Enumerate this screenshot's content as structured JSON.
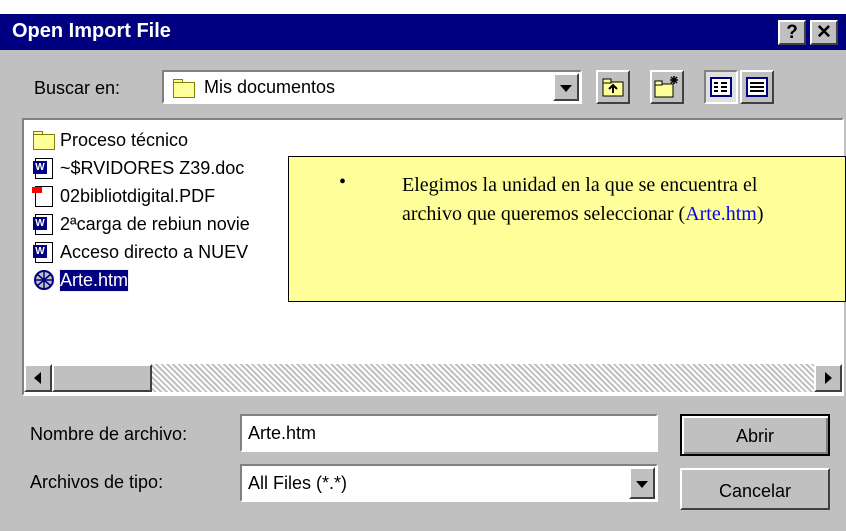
{
  "window": {
    "title": "Open Import File",
    "help_label": "?",
    "close_label": "✕"
  },
  "lookin": {
    "label": "Buscar en:",
    "value": "Mis documentos"
  },
  "toolbar": {
    "up_icon": "up-folder-icon",
    "newfolder_icon": "new-folder-icon",
    "list_icon": "list-view-icon",
    "details_icon": "details-view-icon"
  },
  "files": [
    {
      "name": "Proceso técnico",
      "icon": "folder-icon"
    },
    {
      "name": "~$RVIDORES Z39.doc",
      "icon": "word-doc-icon"
    },
    {
      "name": "02bibliotdigital.PDF",
      "icon": "pdf-icon"
    },
    {
      "name": "2ªcarga de rebiun novie",
      "icon": "word-doc-icon"
    },
    {
      "name": "Acceso directo a NUEV",
      "icon": "shortcut-icon"
    },
    {
      "name": "Arte.htm",
      "icon": "html-file-icon",
      "selected": true
    }
  ],
  "callout": {
    "bullet": "•",
    "text_main": "Elegimos la unidad en la que se encuentra el archivo que queremos seleccionar (",
    "text_link": "Arte.htm",
    "text_end": ")"
  },
  "filename": {
    "label": "Nombre de archivo:",
    "value": "Arte.htm"
  },
  "filetype": {
    "label": "Archivos de tipo:",
    "value": "All Files (*.*)"
  },
  "buttons": {
    "open": "Abrir",
    "cancel": "Cancelar"
  },
  "colors": {
    "titlebar": "#000080",
    "face": "#c0c0c0",
    "callout": "#ffff99",
    "link": "#0000ff"
  }
}
